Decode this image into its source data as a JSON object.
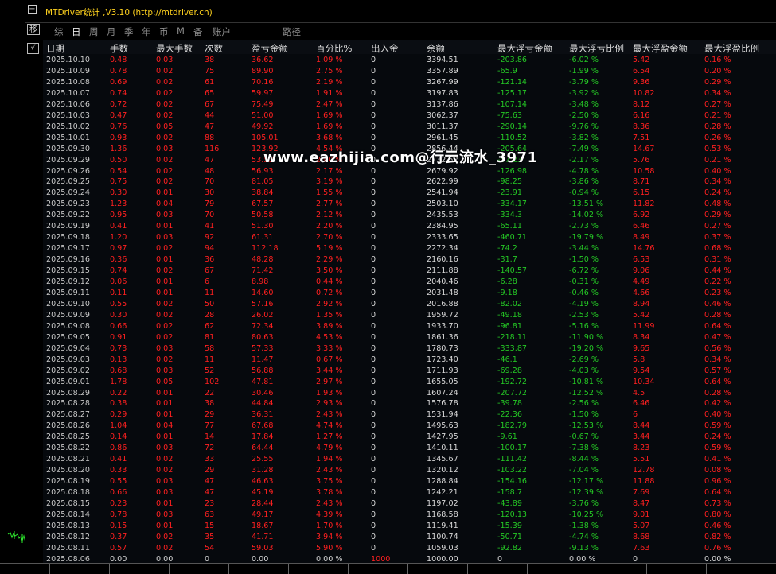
{
  "app_title": "MTDriver统计 ,V3.10 (http://mtdriver.cn)",
  "toolbar": {
    "move_btn": "移",
    "check_btn": "√",
    "collapse_btn": "−",
    "periods": [
      "综",
      "日",
      "周",
      "月",
      "季",
      "年",
      "币",
      "M",
      "备",
      "账户",
      "路径"
    ],
    "active": "日"
  },
  "watermark": "www.eazhijia.com@行云流水_3971",
  "columns": [
    "日期",
    "手数",
    "最大手数",
    "次数",
    "盈亏金额",
    "百分比%",
    "出入金",
    "余额",
    "最大浮亏金额",
    "最大浮亏比例",
    "最大浮盈金额",
    "最大浮盈比例"
  ],
  "rows": [
    [
      "2025.10.10",
      "0.48",
      "0.03",
      "38",
      "36.62",
      "1.09 %",
      "0",
      "3394.51",
      "-203.86",
      "-6.02 %",
      "5.42",
      "0.16 %"
    ],
    [
      "2025.10.09",
      "0.78",
      "0.02",
      "75",
      "89.90",
      "2.75 %",
      "0",
      "3357.89",
      "-65.9",
      "-1.99 %",
      "6.54",
      "0.20 %"
    ],
    [
      "2025.10.08",
      "0.69",
      "0.02",
      "61",
      "70.16",
      "2.19 %",
      "0",
      "3267.99",
      "-121.14",
      "-3.79 %",
      "9.36",
      "0.29 %"
    ],
    [
      "2025.10.07",
      "0.74",
      "0.02",
      "65",
      "59.97",
      "1.91 %",
      "0",
      "3197.83",
      "-125.17",
      "-3.92 %",
      "10.82",
      "0.34 %"
    ],
    [
      "2025.10.06",
      "0.72",
      "0.02",
      "67",
      "75.49",
      "2.47 %",
      "0",
      "3137.86",
      "-107.14",
      "-3.48 %",
      "8.12",
      "0.27 %"
    ],
    [
      "2025.10.03",
      "0.47",
      "0.02",
      "44",
      "51.00",
      "1.69 %",
      "0",
      "3062.37",
      "-75.63",
      "-2.50 %",
      "6.16",
      "0.21 %"
    ],
    [
      "2025.10.02",
      "0.76",
      "0.05",
      "47",
      "49.92",
      "1.69 %",
      "0",
      "3011.37",
      "-290.14",
      "-9.76 %",
      "8.36",
      "0.28 %"
    ],
    [
      "2025.10.01",
      "0.93",
      "0.02",
      "88",
      "105.01",
      "3.68 %",
      "0",
      "2961.45",
      "-110.52",
      "-3.82 %",
      "7.51",
      "0.26 %"
    ],
    [
      "2025.09.30",
      "1.36",
      "0.03",
      "116",
      "123.92",
      "4.54 %",
      "0",
      "2856.44",
      "-205.64",
      "-7.49 %",
      "14.67",
      "0.53 %"
    ],
    [
      "2025.09.29",
      "0.50",
      "0.02",
      "47",
      "53.53",
      "2.00 %",
      "0",
      "2732.52",
      "-57.23",
      "-2.17 %",
      "5.76",
      "0.21 %"
    ],
    [
      "2025.09.26",
      "0.54",
      "0.02",
      "48",
      "56.93",
      "2.17 %",
      "0",
      "2679.92",
      "-126.98",
      "-4.78 %",
      "10.58",
      "0.40 %"
    ],
    [
      "2025.09.25",
      "0.75",
      "0.02",
      "70",
      "81.05",
      "3.19 %",
      "0",
      "2622.99",
      "-98.25",
      "-3.86 %",
      "8.71",
      "0.34 %"
    ],
    [
      "2025.09.24",
      "0.30",
      "0.01",
      "30",
      "38.84",
      "1.55 %",
      "0",
      "2541.94",
      "-23.91",
      "-0.94 %",
      "6.15",
      "0.24 %"
    ],
    [
      "2025.09.23",
      "1.23",
      "0.04",
      "79",
      "67.57",
      "2.77 %",
      "0",
      "2503.10",
      "-334.17",
      "-13.51 %",
      "11.82",
      "0.48 %"
    ],
    [
      "2025.09.22",
      "0.95",
      "0.03",
      "70",
      "50.58",
      "2.12 %",
      "0",
      "2435.53",
      "-334.3",
      "-14.02 %",
      "6.92",
      "0.29 %"
    ],
    [
      "2025.09.19",
      "0.41",
      "0.01",
      "41",
      "51.30",
      "2.20 %",
      "0",
      "2384.95",
      "-65.11",
      "-2.73 %",
      "6.46",
      "0.27 %"
    ],
    [
      "2025.09.18",
      "1.20",
      "0.03",
      "92",
      "61.31",
      "2.70 %",
      "0",
      "2333.65",
      "-460.71",
      "-19.79 %",
      "8.49",
      "0.37 %"
    ],
    [
      "2025.09.17",
      "0.97",
      "0.02",
      "94",
      "112.18",
      "5.19 %",
      "0",
      "2272.34",
      "-74.2",
      "-3.44 %",
      "14.76",
      "0.68 %"
    ],
    [
      "2025.09.16",
      "0.36",
      "0.01",
      "36",
      "48.28",
      "2.29 %",
      "0",
      "2160.16",
      "-31.7",
      "-1.50 %",
      "6.53",
      "0.31 %"
    ],
    [
      "2025.09.15",
      "0.74",
      "0.02",
      "67",
      "71.42",
      "3.50 %",
      "0",
      "2111.88",
      "-140.57",
      "-6.72 %",
      "9.06",
      "0.44 %"
    ],
    [
      "2025.09.12",
      "0.06",
      "0.01",
      "6",
      "8.98",
      "0.44 %",
      "0",
      "2040.46",
      "-6.28",
      "-0.31 %",
      "4.49",
      "0.22 %"
    ],
    [
      "2025.09.11",
      "0.11",
      "0.01",
      "11",
      "14.60",
      "0.72 %",
      "0",
      "2031.48",
      "-9.18",
      "-0.46 %",
      "4.66",
      "0.23 %"
    ],
    [
      "2025.09.10",
      "0.55",
      "0.02",
      "50",
      "57.16",
      "2.92 %",
      "0",
      "2016.88",
      "-82.02",
      "-4.19 %",
      "8.94",
      "0.46 %"
    ],
    [
      "2025.09.09",
      "0.30",
      "0.02",
      "28",
      "26.02",
      "1.35 %",
      "0",
      "1959.72",
      "-49.18",
      "-2.53 %",
      "5.42",
      "0.28 %"
    ],
    [
      "2025.09.08",
      "0.66",
      "0.02",
      "62",
      "72.34",
      "3.89 %",
      "0",
      "1933.70",
      "-96.81",
      "-5.16 %",
      "11.99",
      "0.64 %"
    ],
    [
      "2025.09.05",
      "0.91",
      "0.02",
      "81",
      "80.63",
      "4.53 %",
      "0",
      "1861.36",
      "-218.11",
      "-11.90 %",
      "8.34",
      "0.47 %"
    ],
    [
      "2025.09.04",
      "0.73",
      "0.03",
      "58",
      "57.33",
      "3.33 %",
      "0",
      "1780.73",
      "-333.87",
      "-19.20 %",
      "9.65",
      "0.56 %"
    ],
    [
      "2025.09.03",
      "0.13",
      "0.02",
      "11",
      "11.47",
      "0.67 %",
      "0",
      "1723.40",
      "-46.1",
      "-2.69 %",
      "5.8",
      "0.34 %"
    ],
    [
      "2025.09.02",
      "0.68",
      "0.03",
      "52",
      "56.88",
      "3.44 %",
      "0",
      "1711.93",
      "-69.28",
      "-4.03 %",
      "9.54",
      "0.57 %"
    ],
    [
      "2025.09.01",
      "1.78",
      "0.05",
      "102",
      "47.81",
      "2.97 %",
      "0",
      "1655.05",
      "-192.72",
      "-10.81 %",
      "10.34",
      "0.64 %"
    ],
    [
      "2025.08.29",
      "0.22",
      "0.01",
      "22",
      "30.46",
      "1.93 %",
      "0",
      "1607.24",
      "-207.72",
      "-12.52 %",
      "4.5",
      "0.28 %"
    ],
    [
      "2025.08.28",
      "0.38",
      "0.01",
      "38",
      "44.84",
      "2.93 %",
      "0",
      "1576.78",
      "-39.78",
      "-2.56 %",
      "6.46",
      "0.42 %"
    ],
    [
      "2025.08.27",
      "0.29",
      "0.01",
      "29",
      "36.31",
      "2.43 %",
      "0",
      "1531.94",
      "-22.36",
      "-1.50 %",
      "6",
      "0.40 %"
    ],
    [
      "2025.08.26",
      "1.04",
      "0.04",
      "77",
      "67.68",
      "4.74 %",
      "0",
      "1495.63",
      "-182.79",
      "-12.53 %",
      "8.44",
      "0.59 %"
    ],
    [
      "2025.08.25",
      "0.14",
      "0.01",
      "14",
      "17.84",
      "1.27 %",
      "0",
      "1427.95",
      "-9.61",
      "-0.67 %",
      "3.44",
      "0.24 %"
    ],
    [
      "2025.08.22",
      "0.86",
      "0.03",
      "72",
      "64.44",
      "4.79 %",
      "0",
      "1410.11",
      "-100.17",
      "-7.38 %",
      "8.23",
      "0.59 %"
    ],
    [
      "2025.08.21",
      "0.41",
      "0.02",
      "33",
      "25.55",
      "1.94 %",
      "0",
      "1345.67",
      "-111.42",
      "-8.44 %",
      "5.51",
      "0.41 %"
    ],
    [
      "2025.08.20",
      "0.33",
      "0.02",
      "29",
      "31.28",
      "2.43 %",
      "0",
      "1320.12",
      "-103.22",
      "-7.04 %",
      "12.78",
      "0.08 %"
    ],
    [
      "2025.08.19",
      "0.55",
      "0.03",
      "47",
      "46.63",
      "3.75 %",
      "0",
      "1288.84",
      "-154.16",
      "-12.17 %",
      "11.88",
      "0.96 %"
    ],
    [
      "2025.08.18",
      "0.66",
      "0.03",
      "47",
      "45.19",
      "3.78 %",
      "0",
      "1242.21",
      "-158.7",
      "-12.39 %",
      "7.69",
      "0.64 %"
    ],
    [
      "2025.08.15",
      "0.23",
      "0.01",
      "23",
      "28.44",
      "2.43 %",
      "0",
      "1197.02",
      "-43.89",
      "-3.76 %",
      "8.47",
      "0.73 %"
    ],
    [
      "2025.08.14",
      "0.78",
      "0.03",
      "63",
      "49.17",
      "4.39 %",
      "0",
      "1168.58",
      "-120.13",
      "-10.25 %",
      "9.01",
      "0.80 %"
    ],
    [
      "2025.08.13",
      "0.15",
      "0.01",
      "15",
      "18.67",
      "1.70 %",
      "0",
      "1119.41",
      "-15.39",
      "-1.38 %",
      "5.07",
      "0.46 %"
    ],
    [
      "2025.08.12",
      "0.37",
      "0.02",
      "35",
      "41.71",
      "3.94 %",
      "0",
      "1100.74",
      "-50.71",
      "-4.74 %",
      "8.68",
      "0.82 %"
    ],
    [
      "2025.08.11",
      "0.57",
      "0.02",
      "54",
      "59.03",
      "5.90 %",
      "0",
      "1059.03",
      "-92.82",
      "-9.13 %",
      "7.63",
      "0.76 %"
    ],
    [
      "2025.08.06",
      "0.00",
      "0.00",
      "0",
      "0.00",
      "0.00 %",
      "1000",
      "1000.00",
      "0",
      "0.00 %",
      "0",
      "0.00 %"
    ]
  ]
}
